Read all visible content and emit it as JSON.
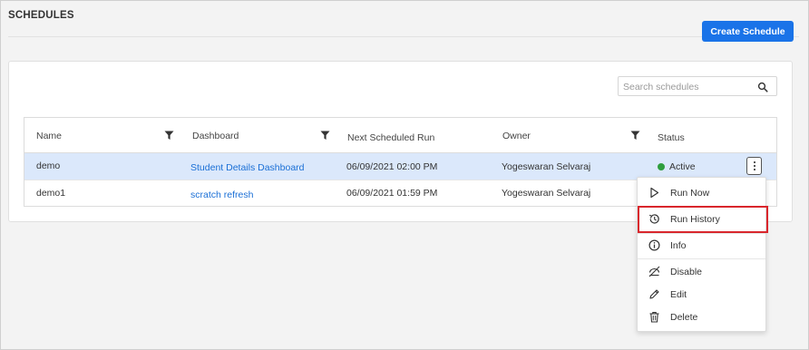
{
  "page": {
    "title": "SCHEDULES",
    "create_button": "Create Schedule"
  },
  "search": {
    "placeholder": "Search schedules"
  },
  "table": {
    "columns": [
      "Name",
      "Dashboard",
      "Next Scheduled Run",
      "Owner",
      "Status"
    ],
    "filterable_columns": [
      "Name",
      "Dashboard",
      "Owner"
    ],
    "rows": [
      {
        "name": "demo",
        "dashboard": "Student Details Dashboard",
        "next_run": "06/09/2021 02:00 PM",
        "owner": "Yogeswaran Selvaraj",
        "status": "Active",
        "selected": true
      },
      {
        "name": "demo1",
        "dashboard": "scratch refresh",
        "next_run": "06/09/2021 01:59 PM",
        "owner": "Yogeswaran Selvaraj",
        "status": "",
        "selected": false
      }
    ]
  },
  "context_menu": {
    "items": [
      {
        "label": "Run Now",
        "icon": "play-outline-icon"
      },
      {
        "label": "Run History",
        "icon": "history-icon",
        "highlighted": true
      },
      {
        "label": "Info",
        "icon": "info-icon"
      },
      {
        "label": "Disable",
        "icon": "disable-icon"
      },
      {
        "label": "Edit",
        "icon": "pencil-icon"
      },
      {
        "label": "Delete",
        "icon": "trash-icon"
      }
    ]
  },
  "colors": {
    "primary": "#1a73e8",
    "link": "#1a6fd6",
    "selected_row": "#dbe8fb",
    "status_active": "#2e9e3e",
    "highlight_box": "#d9262c"
  }
}
